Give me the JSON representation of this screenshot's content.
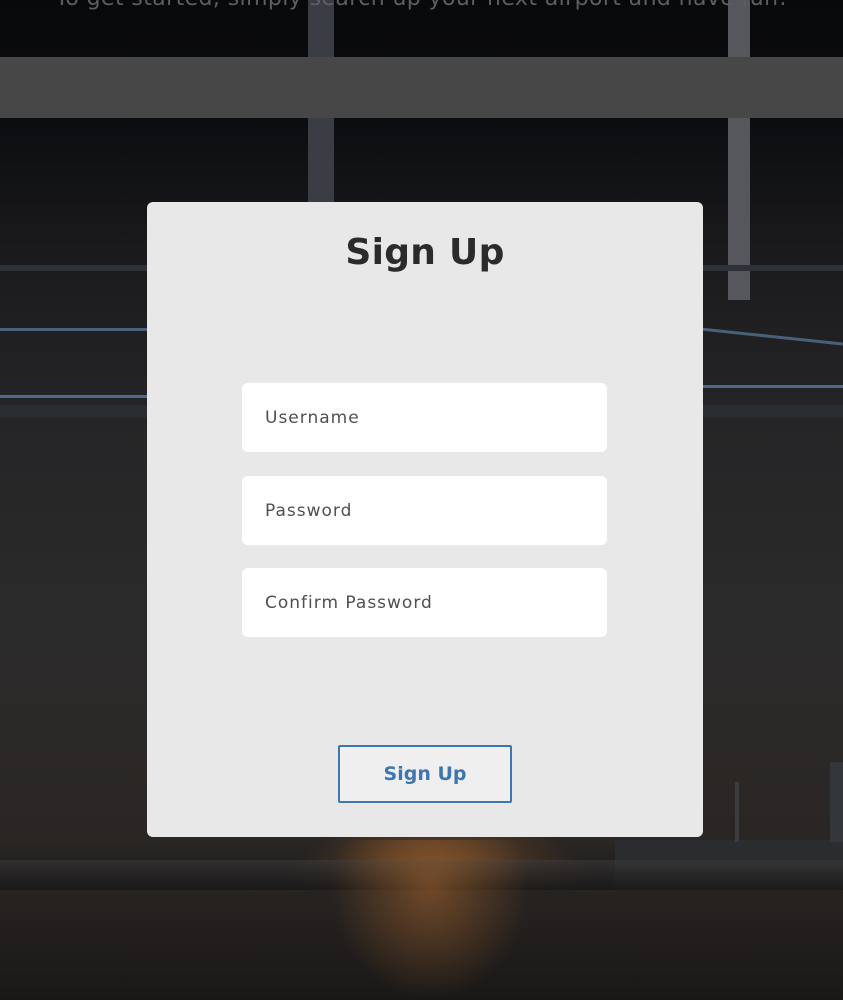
{
  "intro": {
    "text": "To get started, simply search up your next airport and have fun!"
  },
  "search_bar": {
    "placeholder": ""
  },
  "signup_modal": {
    "title": "Sign Up",
    "username_placeholder": "Username",
    "password_placeholder": "Password",
    "confirm_password_placeholder": "Confirm Password",
    "submit_label": "Sign Up"
  },
  "colors": {
    "modal_background": "#e8e8e8",
    "accent": "#3e76b0",
    "overlay": "#474747"
  }
}
